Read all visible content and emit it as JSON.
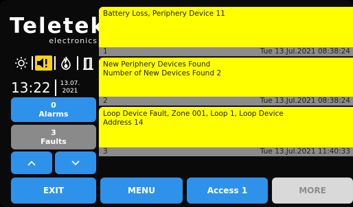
{
  "logo": {
    "brand": "Teletek",
    "sub": "electronics"
  },
  "status_icons": [
    "sun-icon",
    "speaker-warning-icon",
    "fire-icon",
    "door-exit-icon"
  ],
  "clock": {
    "time": "13:22",
    "date_top": "13.07.",
    "date_bottom": "2021"
  },
  "counters": {
    "alarms": {
      "count": "0",
      "label": "Alarms"
    },
    "faults": {
      "count": "3",
      "label": "Faults"
    }
  },
  "nav": {
    "up": "^",
    "down": "v"
  },
  "events": [
    {
      "text": "Battery Loss, Periphery Device 11",
      "index": "1",
      "timestamp": "Tue 13.Jul.2021 08:38:24"
    },
    {
      "text": "New Periphery Devices Found\nNumber of New Devices Found 2",
      "line1": "New Periphery Devices Found",
      "line2": "Number of New Devices Found 2",
      "index": "2",
      "timestamp": "Tue 13.Jul.2021 08:38:24"
    },
    {
      "text": "Loop Device Fault, Zone 001, Loop 1, Loop Device Address 14",
      "line1": "Loop Device Fault, Zone 001, Loop 1, Loop Device",
      "line2": "Address 14",
      "index": "3",
      "timestamp": "Tue 13.Jul.2021 11:40:33"
    }
  ],
  "bottom_bar": {
    "exit": "EXIT",
    "menu": "MENU",
    "access": "Access 1",
    "more": "MORE"
  },
  "colors": {
    "event_bg": "#ffff00",
    "button_blue": "#2e92ea",
    "button_gray": "#8a8a8a",
    "warning": "#f2d21b"
  }
}
